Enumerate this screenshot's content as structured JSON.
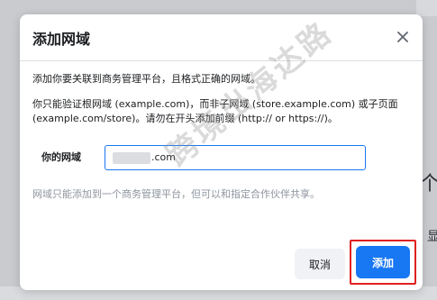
{
  "dialog": {
    "title": "添加网域",
    "intro": "添加你要关联到商务管理平台，且格式正确的网域。",
    "description": "你只能验证根网域 (example.com)，而非子网域 (store.example.com) 或子页面 (example.com/store)。请勿在开头添加前缀 (http:// or https://)。",
    "field_label": "你的网域",
    "field_value_suffix": ".com",
    "hint": "网域只能添加到一个商务管理平台，但可以和指定合作伙伴共享。",
    "cancel_label": "取消",
    "add_label": "添加"
  },
  "background": {
    "glyph": "个",
    "glyph2": "显"
  },
  "watermark": "跨境出海达路",
  "colors": {
    "primary": "#1877f2",
    "highlight": "#e02020"
  }
}
